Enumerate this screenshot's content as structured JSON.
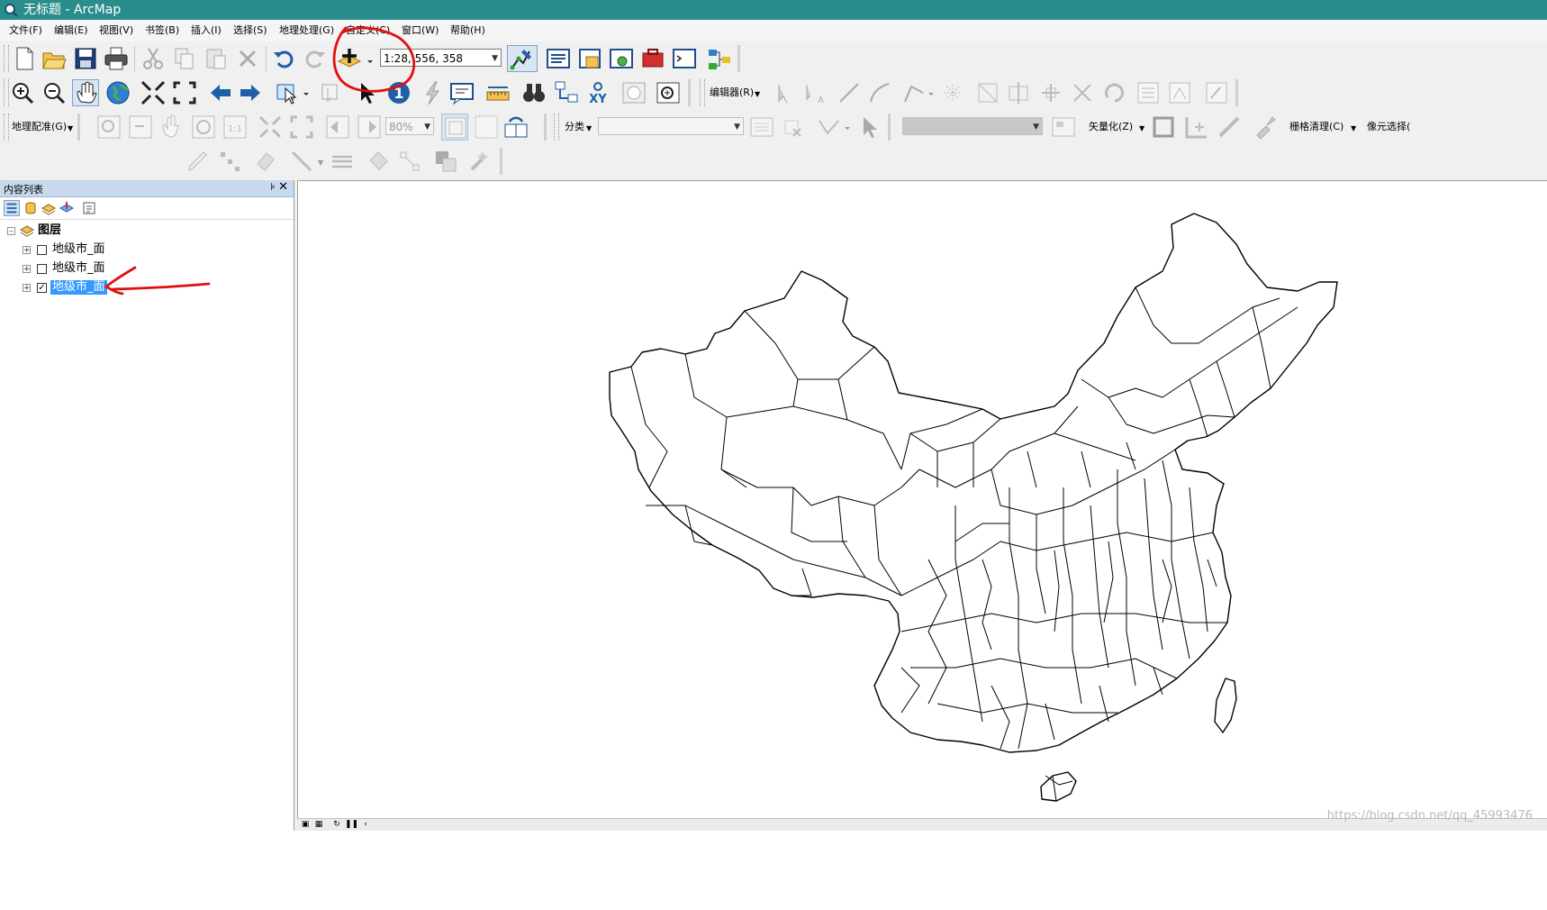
{
  "window": {
    "title": "无标题 - ArcMap",
    "icon": "arcmap-icon"
  },
  "menu": [
    "文件(F)",
    "编辑(E)",
    "视图(V)",
    "书签(B)",
    "插入(I)",
    "选择(S)",
    "地理处理(G)",
    "自定义(C)",
    "窗口(W)",
    "帮助(H)"
  ],
  "toolbar": {
    "scale": "1:2​8, 556, 358",
    "editor_label": "编辑器(R)",
    "georef_label": "地理配准(G)",
    "georef_zoom": "80%",
    "classify_label": "分类",
    "vectorize_label": "矢量化(Z)",
    "raster_cleanup_label": "栅格清理(C)",
    "cell_select_label": "像元选择("
  },
  "toc": {
    "title": "内容列表",
    "pin_icon": "pin-icon",
    "close_icon": "close-icon",
    "root_label": "图层",
    "layers": [
      {
        "label": "地级市_面",
        "checked": false,
        "selected": false
      },
      {
        "label": "地级市_面",
        "checked": false,
        "selected": false
      },
      {
        "label": "地级市_面",
        "checked": true,
        "selected": true
      }
    ]
  },
  "status": {
    "watermark": "https://blog.csdn.net/qq_45993476"
  },
  "colors": {
    "titlebar": "#2a8d8d",
    "selection": "#3399ff",
    "annotation": "#e01010"
  }
}
